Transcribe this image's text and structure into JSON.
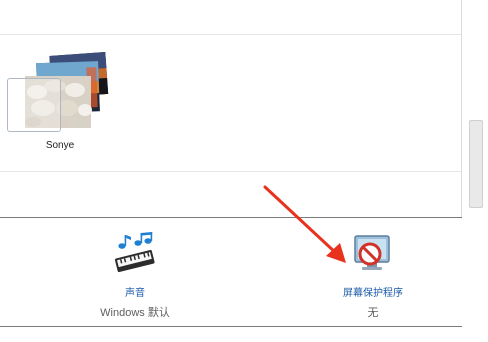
{
  "theme": {
    "name": "Sonye"
  },
  "settings": {
    "sound": {
      "label": "声音",
      "value": "Windows 默认",
      "icon": "sound-icon"
    },
    "screensaver": {
      "label": "屏幕保护程序",
      "value": "无",
      "icon": "screensaver-icon"
    }
  },
  "colors": {
    "link": "#1a5aa8",
    "annotation_arrow": "#e8321d"
  }
}
